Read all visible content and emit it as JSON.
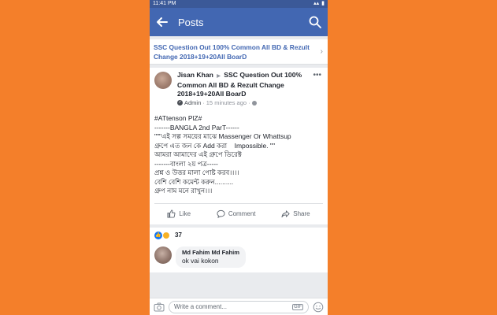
{
  "status_bar": {
    "time": "11:41 PM"
  },
  "app_bar": {
    "title": "Posts"
  },
  "post_title": "SSC Question Out 100% Common All BD & Rezult Change 2018+19+20All BoarD",
  "post": {
    "author": "Jisan Khan",
    "target": "SSC Question Out 100% Common All BD & Rezult Change 2018+19+20All BoarD",
    "role": "Admin",
    "time_ago": "15 minutes ago",
    "body_lines": [
      "#ATtenson PlZ#",
      "",
      "-------BANGLA 2nd ParT------",
      "\"\"\"এই সল্প সময়ের মাঝে Massenger Or Whattsup",
      "গ্রুপে এত জন কে Add করা    Impossible. \"\"",
      "আমরা আমাদের এই গ্রুপে ডিরেক্ট",
      "-------বাংলা ২য় পত্র-----",
      "প্রশ্ন ও উত্তর মালা পোষ্ট করব।।।।",
      "",
      "বেশি বেশি কমেন্ট করুন..........",
      "গ্রুপ নাম মনে রাখুন।।।"
    ]
  },
  "actions": {
    "like": "Like",
    "comment": "Comment",
    "share": "Share"
  },
  "reactions": {
    "count": "37"
  },
  "comment": {
    "author": "Md Fahim Md Fahim",
    "text": "ok vai kokon"
  },
  "composer": {
    "placeholder": "Write a comment...",
    "gif_label": "GIF"
  },
  "colors": {
    "brand": "#4267b2",
    "background": "#f47f2a"
  }
}
